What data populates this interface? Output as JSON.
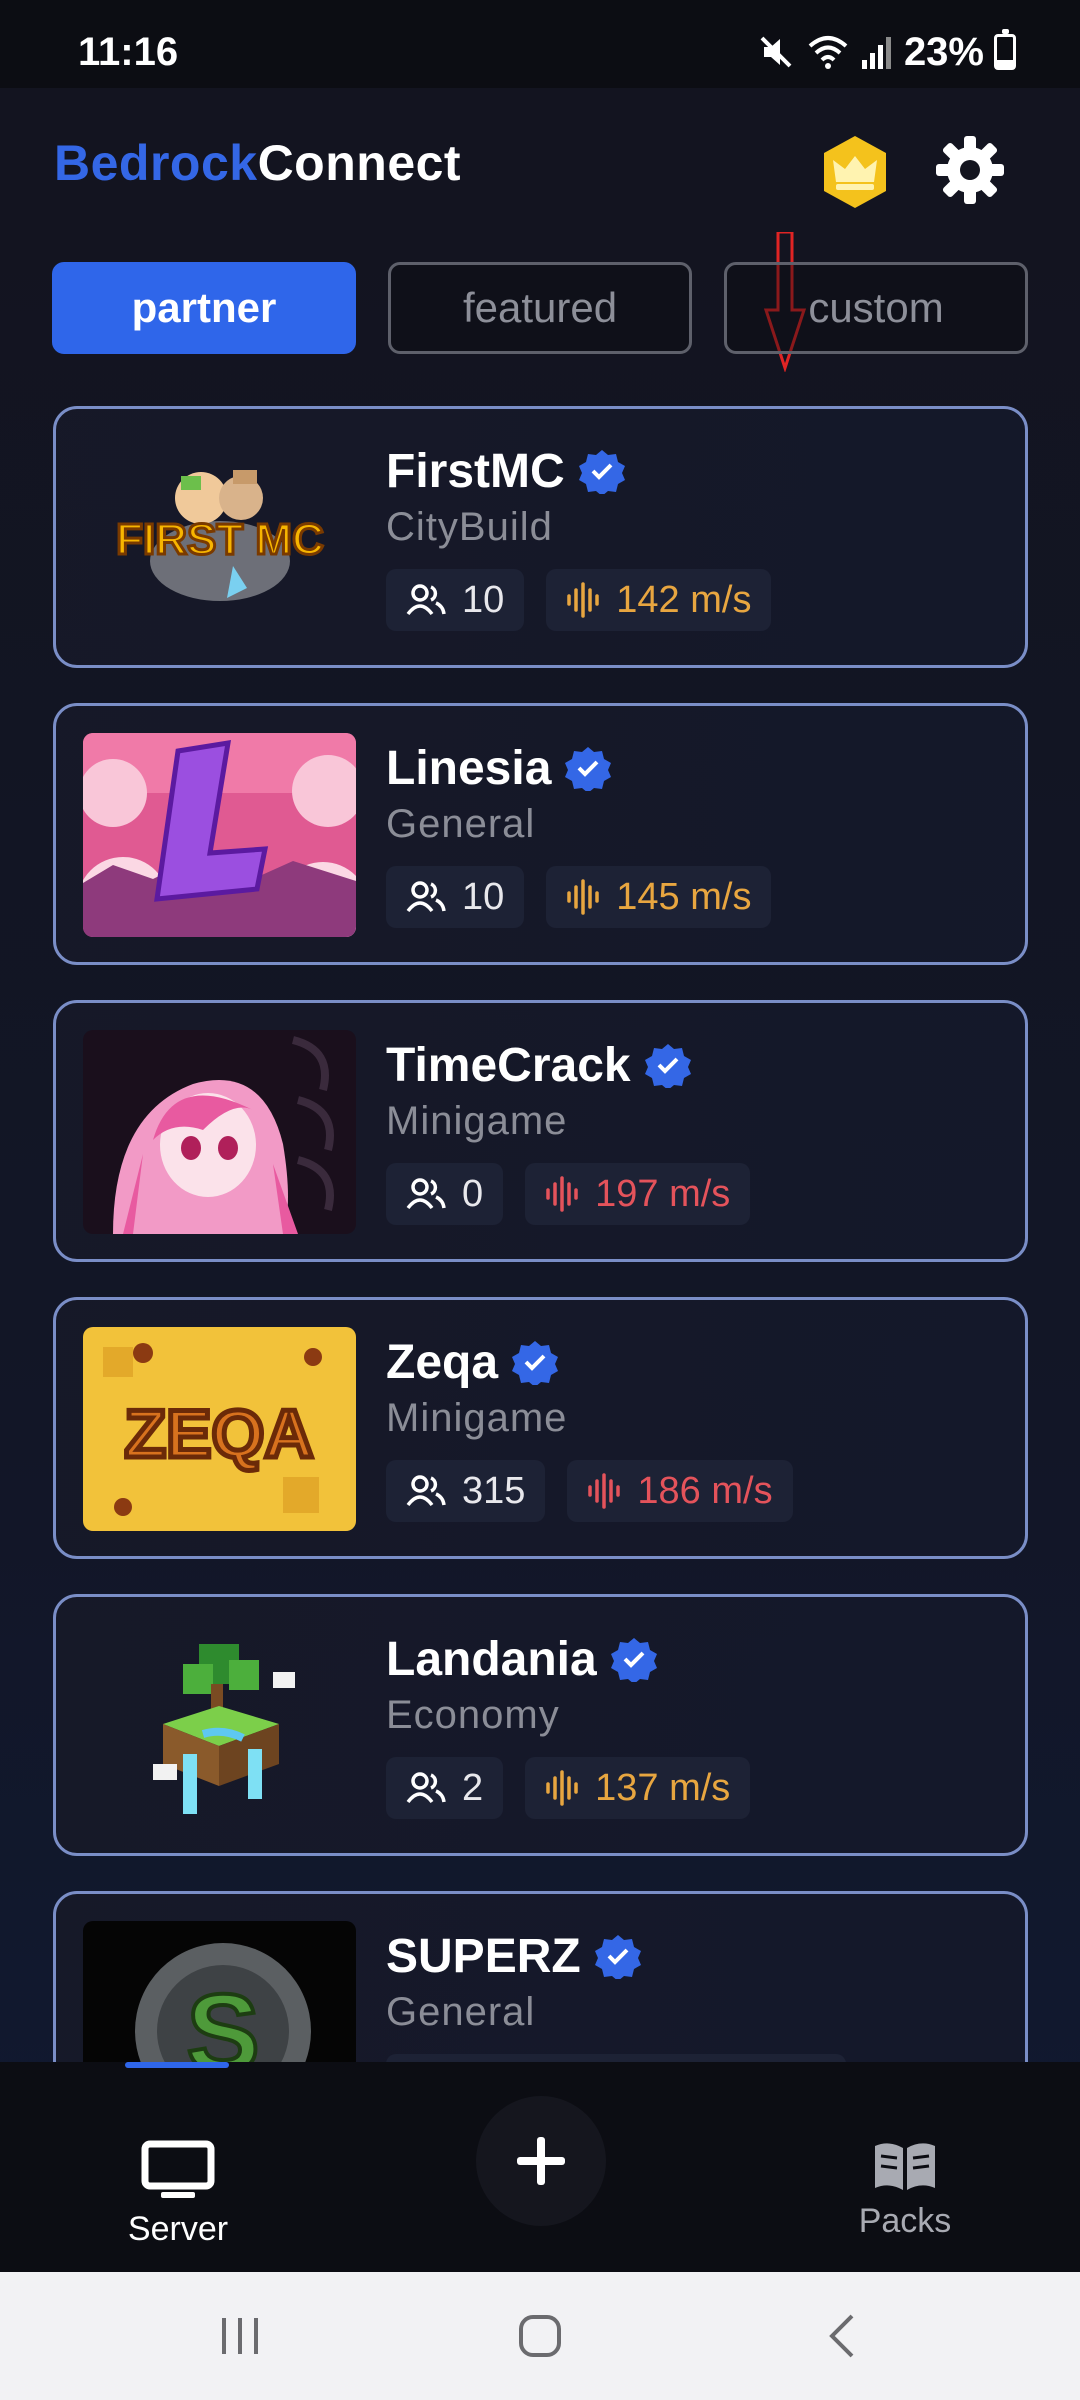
{
  "status_bar": {
    "time": "11:16",
    "battery": "23%",
    "battery_level": 0.23
  },
  "header": {
    "logo_part1": "Bedrock",
    "logo_part2": "Connect",
    "premium_icon": "crown-icon",
    "settings_icon": "gear-icon"
  },
  "tabs": [
    {
      "label": "partner",
      "active": true
    },
    {
      "label": "featured",
      "active": false
    },
    {
      "label": "custom",
      "active": false
    }
  ],
  "servers": [
    {
      "name": "FirstMC",
      "category": "CityBuild",
      "players": "10",
      "ping": "142 m/s",
      "ping_status": "ok"
    },
    {
      "name": "Linesia",
      "category": "General",
      "players": "10",
      "ping": "145 m/s",
      "ping_status": "ok"
    },
    {
      "name": "TimeCrack",
      "category": "Minigame",
      "players": "0",
      "ping": "197 m/s",
      "ping_status": "bad"
    },
    {
      "name": "Zeqa",
      "category": "Minigame",
      "players": "315",
      "ping": "186 m/s",
      "ping_status": "bad"
    },
    {
      "name": "Landania",
      "category": "Economy",
      "players": "2",
      "ping": "137 m/s",
      "ping_status": "ok"
    },
    {
      "name": "SUPERZ",
      "category": "General",
      "players": "",
      "ping": "",
      "ping_status": "ok"
    }
  ],
  "bottom_nav": {
    "server_label": "Server",
    "packs_label": "Packs",
    "add_icon": "plus-icon"
  },
  "colors": {
    "accent": "#2f66ea",
    "ping_ok": "#e8a640",
    "ping_bad": "#e4535b",
    "card_border": "#7a8ec7",
    "annotation": "#e02424"
  }
}
